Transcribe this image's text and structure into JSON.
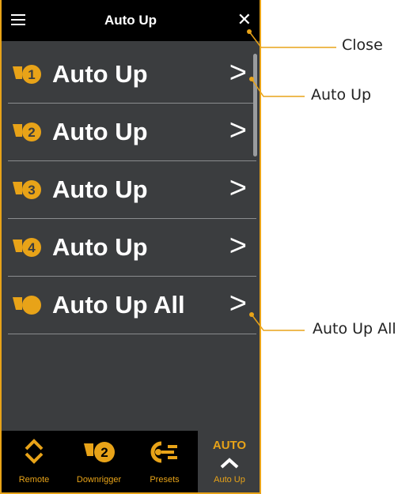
{
  "header": {
    "title": "Auto Up"
  },
  "rows": [
    {
      "number": "1",
      "label": "Auto Up",
      "chevron": ">"
    },
    {
      "number": "2",
      "label": "Auto Up",
      "chevron": ">"
    },
    {
      "number": "3",
      "label": "Auto Up",
      "chevron": ">"
    },
    {
      "number": "4",
      "label": "Auto Up",
      "chevron": ">"
    },
    {
      "number": "",
      "label": "Auto Up All",
      "chevron": ">"
    }
  ],
  "tabs": [
    {
      "label": "Remote",
      "icon": "up-down-chevron-icon"
    },
    {
      "label": "Downrigger",
      "icon": "downrigger-2-icon",
      "number": "2"
    },
    {
      "label": "Presets",
      "icon": "presets-icon"
    },
    {
      "label": "Auto Up",
      "icon": "auto-up-icon",
      "badge": "AUTO",
      "active": true
    }
  ],
  "callouts": {
    "close": "Close",
    "auto_up": "Auto Up",
    "auto_up_all": "Auto Up All"
  },
  "colors": {
    "accent": "#e8a318",
    "panel": "#3b3d3f",
    "bar": "#000000"
  }
}
